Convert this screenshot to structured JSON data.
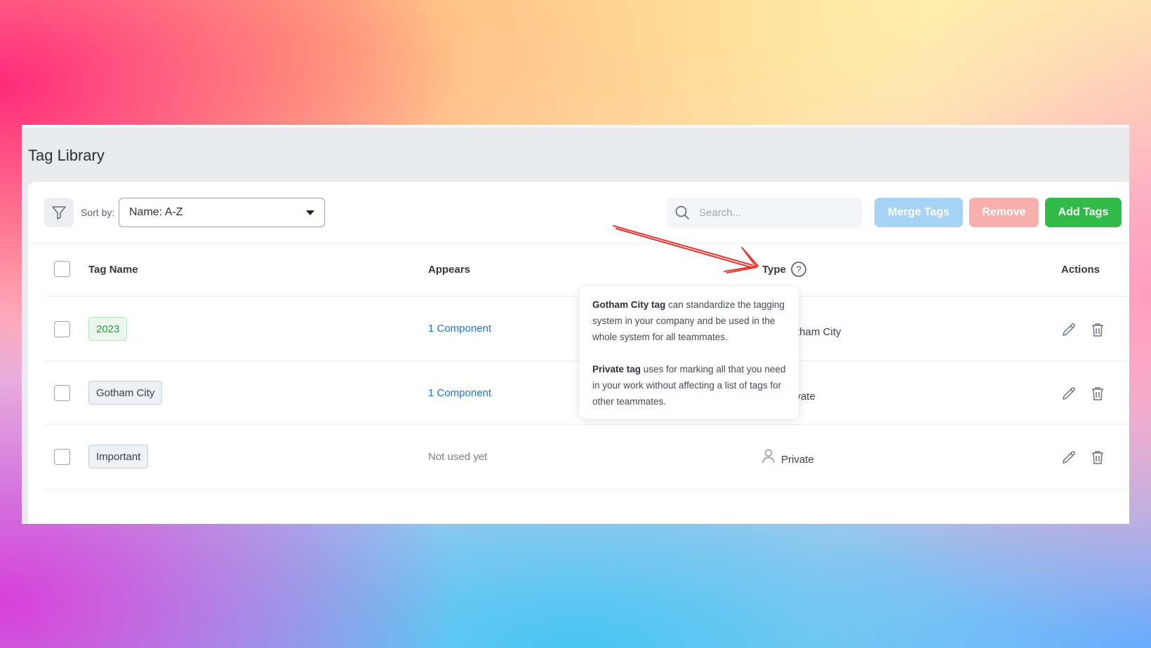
{
  "page_title": "Tag Library",
  "toolbar": {
    "sort_label": "Sort by:",
    "sort_value": "Name: A-Z",
    "search_placeholder": "Search...",
    "merge_label": "Merge Tags",
    "remove_label": "Remove",
    "add_label": "Add Tags"
  },
  "columns": {
    "tag_name": "Tag Name",
    "appears": "Appears",
    "type": "Type",
    "actions": "Actions"
  },
  "rows": [
    {
      "tag": "2023",
      "tag_style": "green",
      "appears": "1 Component",
      "type": "Gotham City"
    },
    {
      "tag": "Gotham City",
      "tag_style": "gray",
      "appears": "1 Component",
      "type": "Private"
    },
    {
      "tag": "Important",
      "tag_style": "gray",
      "appears": "Not used yet",
      "type": "Private"
    }
  ],
  "tooltip": {
    "p1_bold": "Gotham City tag",
    "p1_rest": " can standardize the tagging system in your company and be used in the whole system for all teammates.",
    "p2_bold": "Private tag",
    "p2_rest": " uses for marking all that you need in your work without affecting a list of tags for other teammates."
  },
  "colors": {
    "accent_green": "#2fba4a",
    "merge_blue": "#a7d3f4",
    "remove_red": "#f8b0ae",
    "link_blue": "#1a73d9",
    "annotation_red": "#e8362f"
  },
  "icons": [
    "filter-icon",
    "search-icon",
    "help-circle-icon",
    "user-icon",
    "pencil-icon",
    "trash-icon"
  ]
}
